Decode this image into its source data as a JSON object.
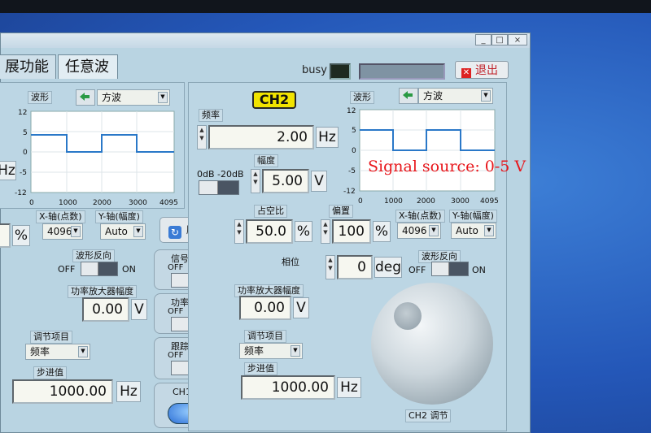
{
  "window": {
    "tabs": [
      "展功能",
      "任意波"
    ],
    "busy_label": "busy",
    "exit_label": "退出",
    "exit_icon": "close-icon"
  },
  "left_panel": {
    "wave_label": "波形",
    "wave_select": "方波",
    "freq_unit": "Hz",
    "graph_y_ticks": [
      "12",
      "5",
      "0",
      "-5",
      "-12"
    ],
    "graph_x_ticks": [
      "0",
      "1000",
      "2000",
      "3000",
      "4095"
    ],
    "percent_unit": "%",
    "xaxis_label": "X-轴(点数)",
    "xaxis_value": "4096",
    "yaxis_label": "Y-轴(幅度)",
    "yaxis_value": "Auto",
    "invert_label": "波形反向",
    "off": "OFF",
    "on": "ON",
    "amp_label": "功率放大器幅度",
    "amp_value": "0.00",
    "amp_unit": "V",
    "adjust_label": "调节项目",
    "adjust_value": "频率",
    "step_label": "步进值",
    "step_value": "1000.00",
    "step_unit": "Hz"
  },
  "middle": {
    "refresh_label": "刷新",
    "signal_out_label": "信号输出",
    "power_out_label": "功率输出",
    "track_label": "跟踪模式",
    "off": "OFF",
    "on": "ON",
    "ch_select_label": "CH1  CH2"
  },
  "ch2": {
    "title": "CH2",
    "freq_label": "频率",
    "freq_value": "2.00",
    "freq_unit": "Hz",
    "range_label": "0dB -20dB",
    "amp_label": "幅度",
    "amp_value": "5.00",
    "amp_unit": "V",
    "wave_label": "波形",
    "wave_select": "方波",
    "graph_y_ticks": [
      "12",
      "5",
      "0",
      "-5",
      "-12"
    ],
    "graph_x_ticks": [
      "0",
      "1000",
      "2000",
      "3000",
      "4095"
    ],
    "duty_label": "占空比",
    "duty_value": "50.0",
    "duty_unit": "%",
    "offset_label": "偏置",
    "offset_value": "100",
    "offset_unit": "%",
    "xaxis_label": "X-轴(点数)",
    "xaxis_value": "4096",
    "yaxis_label": "Y-轴(幅度)",
    "yaxis_value": "Auto",
    "phase_label": "相位",
    "phase_value": "0",
    "phase_unit": "deg",
    "invert_label": "波形反向",
    "off": "OFF",
    "on": "ON",
    "pamp_label": "功率放大器幅度",
    "pamp_value": "0.00",
    "pamp_unit": "V",
    "adjust_label": "调节项目",
    "adjust_value": "频率",
    "step_label": "步进值",
    "step_value": "1000.00",
    "step_unit": "Hz",
    "knob_label": "CH2 调节"
  },
  "annotation": "Signal source: 0-5 V",
  "colors": {
    "panel": "#b9d4e2",
    "trace": "#2a78c8",
    "ch2_badge": "#f1e300",
    "annotation": "#e8151a"
  }
}
